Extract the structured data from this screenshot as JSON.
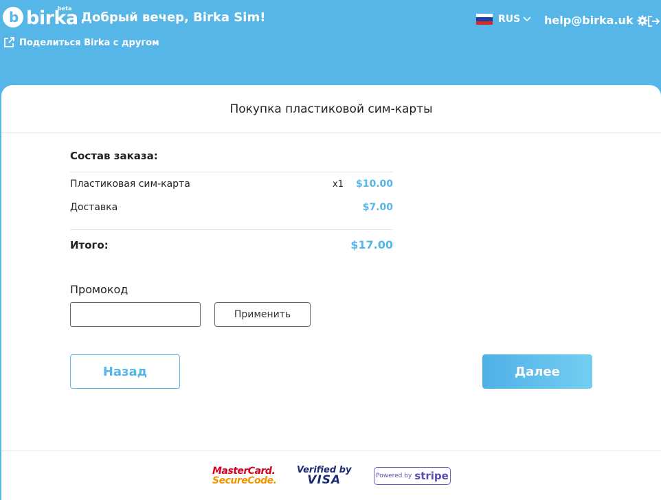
{
  "header": {
    "logo_text": "birka",
    "logo_badge": "beta",
    "greeting": "Добрый вечер, Birka Sim!",
    "share_label": "Поделиться Birka с другом",
    "language": "RUS",
    "help_email": "help@birka.uk"
  },
  "card": {
    "title": "Покупка пластиковой сим-карты",
    "order_heading": "Состав заказа:",
    "items": [
      {
        "name": "Пластиковая сим-карта",
        "qty": "x1",
        "price": "$10.00"
      },
      {
        "name": "Доставка",
        "qty": "",
        "price": "$7.00"
      }
    ],
    "total_label": "Итого:",
    "total_value": "$17.00",
    "promo_label": "Промокод",
    "promo_value": "",
    "apply_label": "Применить",
    "back_label": "Назад",
    "next_label": "Далее"
  },
  "footer": {
    "mastercard_line1": "MasterCard.",
    "mastercard_line2": "SecureCode.",
    "visa_line1": "Verified by",
    "visa_line2": "VISA",
    "stripe_line1": "Powered by",
    "stripe_line2": "stripe"
  },
  "colors": {
    "brand": "#56b6e8",
    "text": "#222222"
  }
}
